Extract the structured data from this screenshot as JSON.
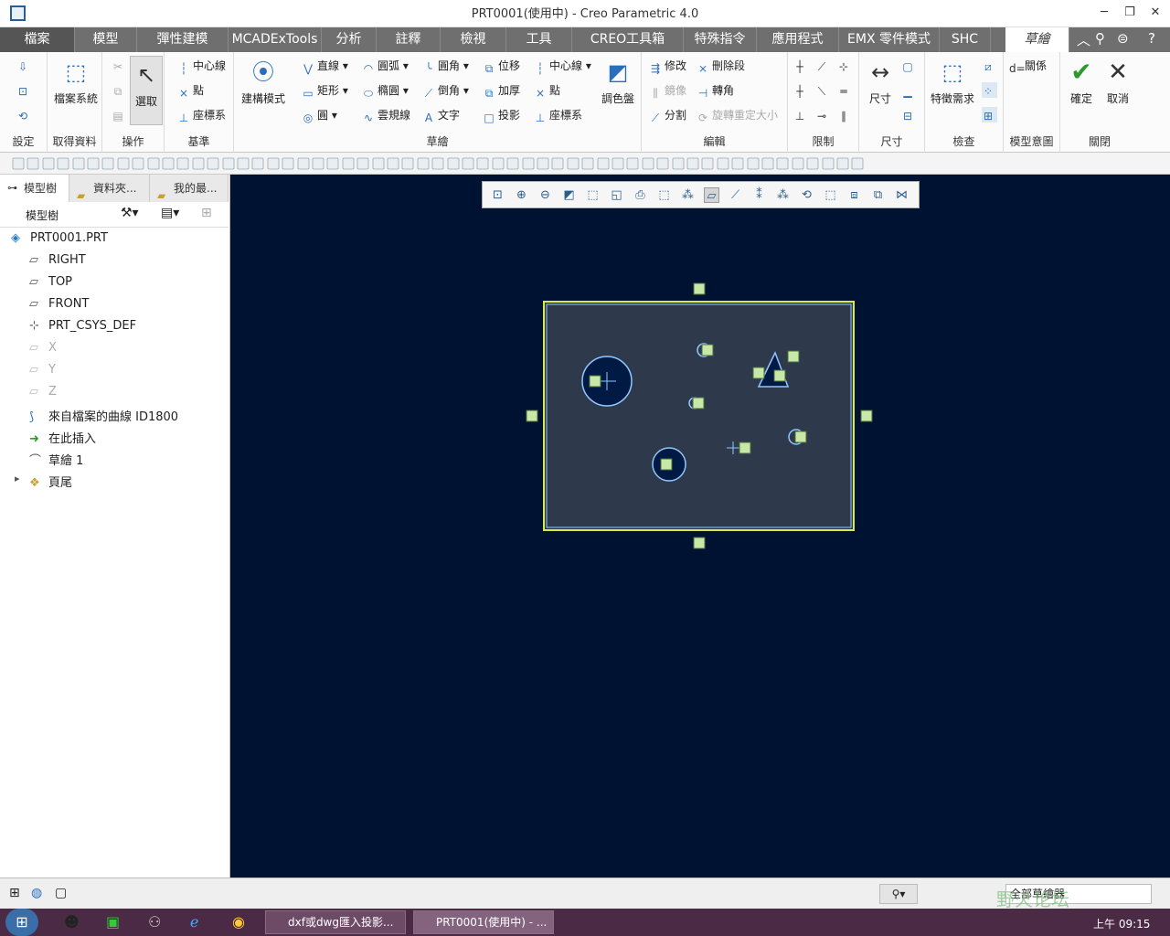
{
  "window": {
    "title": "PRT0001(使用中) - Creo Parametric 4.0"
  },
  "tabs": [
    "檔案",
    "模型",
    "彈性建模",
    "MCADExTools",
    "分析",
    "註釋",
    "檢視",
    "工具",
    "CREO工具箱",
    "特殊指令",
    "應用程式",
    "EMX 零件模式",
    "SHC",
    "草繪"
  ],
  "ribbon": {
    "setup": {
      "label": "設定"
    },
    "get_data": {
      "file_system": "檔案系統",
      "label": "取得資料"
    },
    "operations": {
      "select": "選取",
      "label": "操作"
    },
    "datum": {
      "centerline": "中心線",
      "point": "點",
      "csys": "座標系",
      "label": "基準"
    },
    "sketching": {
      "construction_mode": "建構模式",
      "line": "直線",
      "rectangle": "矩形",
      "circle": "圓",
      "arc": "圓弧",
      "ellipse": "橢圓",
      "spline": "雲規線",
      "fillet": "圓角",
      "chamfer": "倒角",
      "text": "文字",
      "offset": "位移",
      "thicken": "加厚",
      "project": "投影",
      "centerline": "中心線",
      "point": "點",
      "csys": "座標系",
      "palette": "調色盤",
      "label": "草繪"
    },
    "editing": {
      "modify": "修改",
      "delete_segment": "刪除段",
      "mirror": "鏡像",
      "corner": "轉角",
      "divide": "分割",
      "rotate_resize": "旋轉重定大小",
      "label": "編輯"
    },
    "constrain": {
      "label": "限制"
    },
    "dimension": {
      "dimension": "尺寸",
      "label": "尺寸"
    },
    "inspect": {
      "feature_req": "特徵需求",
      "label": "檢查"
    },
    "intent": {
      "relations": "關係",
      "label": "模型意圖"
    },
    "close": {
      "ok": "確定",
      "cancel": "取消",
      "label": "關閉"
    }
  },
  "panel": {
    "tabs": [
      "模型樹",
      "資料夾...",
      "我的最..."
    ],
    "tree_label": "模型樹",
    "items": [
      {
        "label": "PRT0001.PRT",
        "dim": false
      },
      {
        "label": "RIGHT",
        "dim": false
      },
      {
        "label": "TOP",
        "dim": false
      },
      {
        "label": "FRONT",
        "dim": false
      },
      {
        "label": "PRT_CSYS_DEF",
        "dim": false
      },
      {
        "label": "X",
        "dim": true
      },
      {
        "label": "Y",
        "dim": true
      },
      {
        "label": "Z",
        "dim": true
      },
      {
        "label": "來自檔案的曲線 ID1800",
        "dim": false
      },
      {
        "label": "在此插入",
        "dim": false
      },
      {
        "label": "草繪 1",
        "dim": false
      },
      {
        "label": "頁尾",
        "dim": false
      }
    ]
  },
  "status": {
    "filter": "全部草繪器"
  },
  "taskbar": {
    "items": [
      "dxf或dwg匯入投影...",
      "PRT0001(使用中) - ..."
    ],
    "clock": "上午 09:15",
    "watermark": "野火论坛"
  },
  "colors": {
    "viewport_bg": "#001231",
    "sketch_fill": "#2e3a4c",
    "sketch_edge": "#d9e84a",
    "geometry": "#8ec8ff",
    "constraint": "#c8e8a8"
  }
}
